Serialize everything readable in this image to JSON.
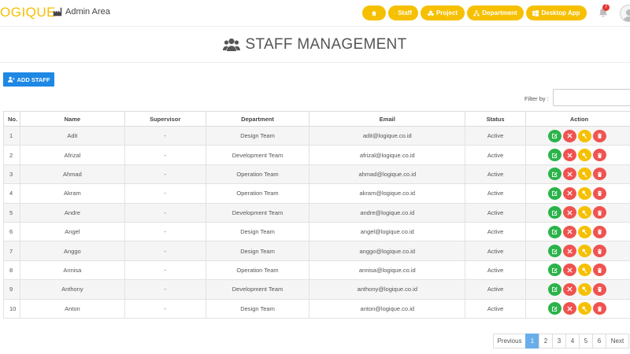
{
  "header": {
    "logo": "OGIQUE",
    "admin_area": "Admin Area",
    "nav": [
      {
        "label": "",
        "icon": "home-icon"
      },
      {
        "label": "Staff",
        "icon": "users-icon"
      },
      {
        "label": "Project",
        "icon": "cubes-icon"
      },
      {
        "label": "Department",
        "icon": "sitemap-icon"
      },
      {
        "label": "Desktop App",
        "icon": "windows-icon"
      }
    ],
    "notification_count": "7"
  },
  "page": {
    "title": "STAFF MANAGEMENT",
    "add_button": "ADD STAFF",
    "filter_label": "Filter by :"
  },
  "table": {
    "headers": [
      "No.",
      "Name",
      "Supervisor",
      "Department",
      "Email",
      "Status",
      "Action"
    ],
    "rows": [
      {
        "no": "1",
        "name": "Adit",
        "supervisor": "-",
        "department": "Design Team",
        "email": "adit@logique.co.id",
        "status": "Active"
      },
      {
        "no": "2",
        "name": "Afrizal",
        "supervisor": "-",
        "department": "Development Team",
        "email": "afrizal@logique.co.id",
        "status": "Active"
      },
      {
        "no": "3",
        "name": "Ahmad",
        "supervisor": "-",
        "department": "Operation Team",
        "email": "ahmad@logique.co.id",
        "status": "Active"
      },
      {
        "no": "4",
        "name": "Akram",
        "supervisor": "-",
        "department": "Operation Team",
        "email": "akram@logique.co.id",
        "status": "Active"
      },
      {
        "no": "5",
        "name": "Andre",
        "supervisor": "-",
        "department": "Development Team",
        "email": "andre@logique.co.id",
        "status": "Active"
      },
      {
        "no": "6",
        "name": "Angel",
        "supervisor": "-",
        "department": "Design Team",
        "email": "angel@logique.co.id",
        "status": "Active"
      },
      {
        "no": "7",
        "name": "Anggo",
        "supervisor": "-",
        "department": "Design Team",
        "email": "anggo@logique.co.id",
        "status": "Active"
      },
      {
        "no": "8",
        "name": "Annisa",
        "supervisor": "-",
        "department": "Operation Team",
        "email": "annisa@logique.co.id",
        "status": "Active"
      },
      {
        "no": "9",
        "name": "Anthony",
        "supervisor": "-",
        "department": "Development Team",
        "email": "anthony@logique.co.id",
        "status": "Active"
      },
      {
        "no": "10",
        "name": "Anton",
        "supervisor": "-",
        "department": "Design Team",
        "email": "anton@logique.co.id",
        "status": "Active"
      }
    ]
  },
  "pagination": {
    "previous": "Previous",
    "pages": [
      "1",
      "2",
      "3",
      "4",
      "5",
      "6"
    ],
    "active_page": "1",
    "next": "Next"
  },
  "colors": {
    "accent": "#f6c000",
    "primary": "#1e88e5",
    "edit": "#2bb34a",
    "danger": "#ef5350",
    "page_active": "#6aaee9"
  }
}
